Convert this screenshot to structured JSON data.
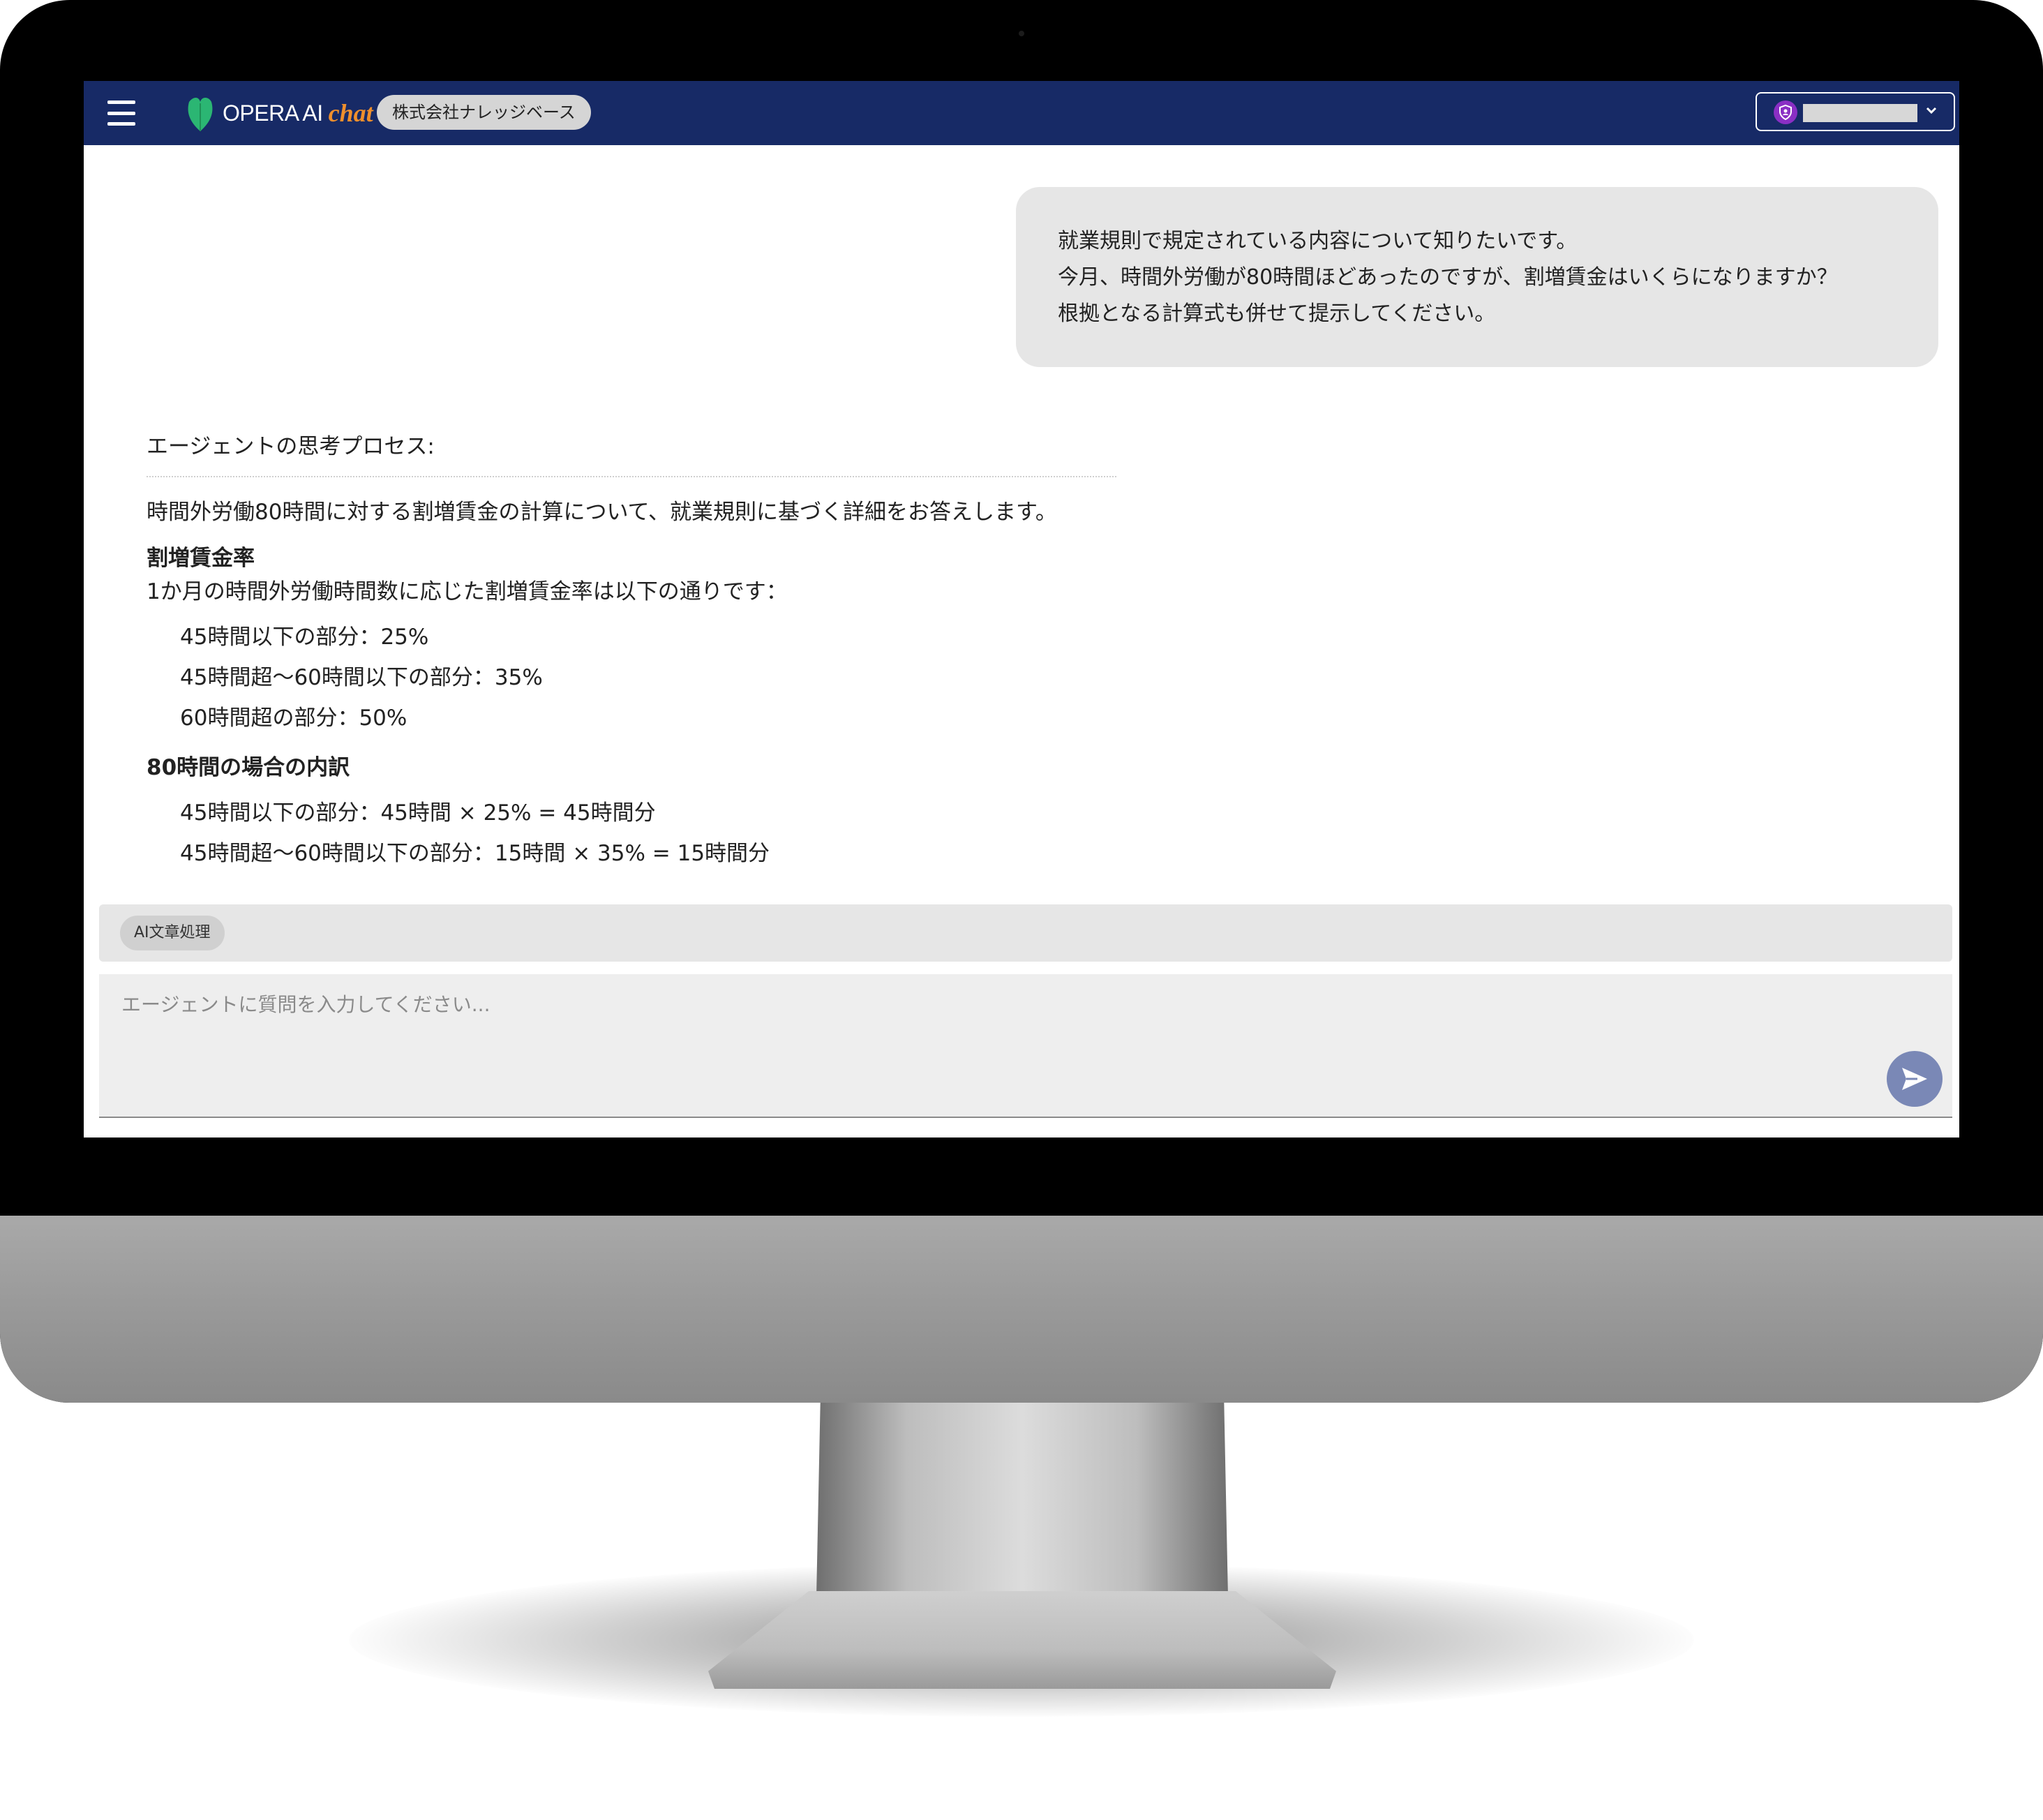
{
  "app": {
    "logo_text": "OPERA AI",
    "logo_chat": "chat",
    "organization": "株式会社ナレッジベース"
  },
  "user_menu": {
    "avatar_icon": "shield-user-icon",
    "chevron_icon": "chevron-down-icon"
  },
  "chat": {
    "user_message": [
      "就業規則で規定されている内容について知りたいです。",
      "今月、時間外労働が80時間ほどあったのですが、割増賃金はいくらになりますか？",
      "根拠となる計算式も併せて提示してください。"
    ],
    "agent": {
      "process_label": "エージェントの思考プロセス:",
      "intro": "時間外労働80時間に対する割増賃金の計算について、就業規則に基づく詳細をお答えします。",
      "section1_heading": "割増賃金率",
      "section1_text": "1か月の時間外労働時間数に応じた割増賃金率は以下の通りです：",
      "rates": [
        "45時間以下の部分：25%",
        "45時間超〜60時間以下の部分：35%",
        "60時間超の部分：50%"
      ],
      "section2_heading": "80時間の場合の内訳",
      "breakdown": [
        "45時間以下の部分：45時間 × 25% = 45時間分",
        "45時間超〜60時間以下の部分：15時間 × 35% = 15時間分"
      ]
    }
  },
  "toolbar": {
    "tool_chip": "AI文章処理"
  },
  "input": {
    "placeholder": "エージェントに質問を入力してください..."
  },
  "colors": {
    "header": "#172a66",
    "accent_orange": "#ef8f2c",
    "logo_green": "#2bb673",
    "send_button": "#7a88b6"
  }
}
